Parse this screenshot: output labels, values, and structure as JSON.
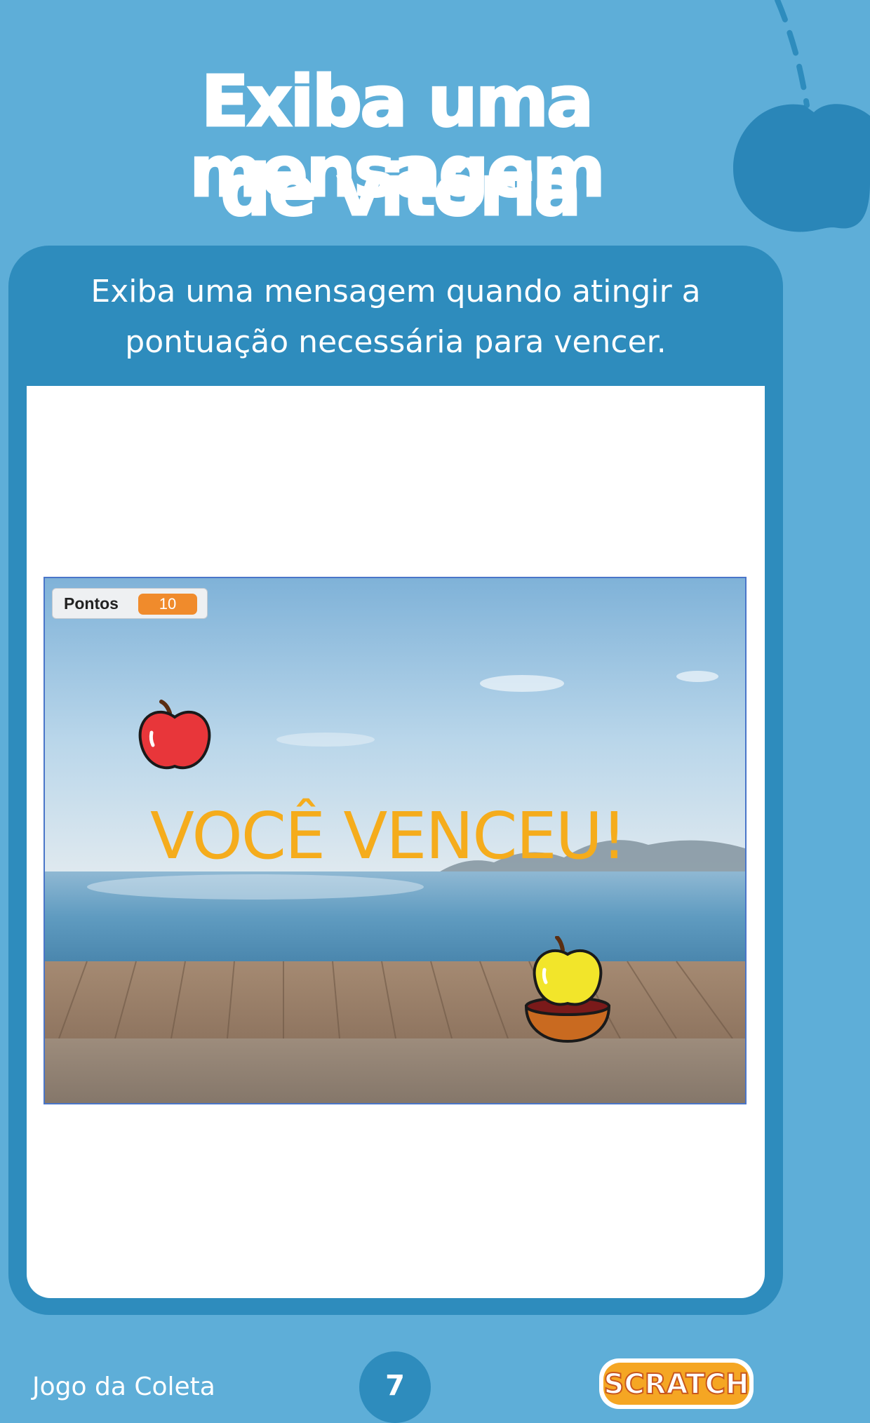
{
  "header": {
    "title_line1": "Exiba uma mensagem",
    "title_line2": "de vitória"
  },
  "card": {
    "subtitle_line1": "Exiba uma mensagem quando atingir a",
    "subtitle_line2": "pontuação necessária para vencer."
  },
  "stage": {
    "score_label": "Pontos",
    "score_value": "10",
    "win_message": "VOCÊ VENCEU!"
  },
  "footer": {
    "project_name": "Jogo da Coleta",
    "page_number": "7",
    "logo_text": "SCRATCH"
  },
  "colors": {
    "background": "#5eaed8",
    "card": "#2e8cbd",
    "accent_orange": "#f5ac1c",
    "score_badge": "#f08b2c"
  },
  "icons": [
    "decorative-apple-icon",
    "red-apple-sprite",
    "yellow-apple-sprite",
    "bowl-sprite",
    "scratch-logo"
  ]
}
